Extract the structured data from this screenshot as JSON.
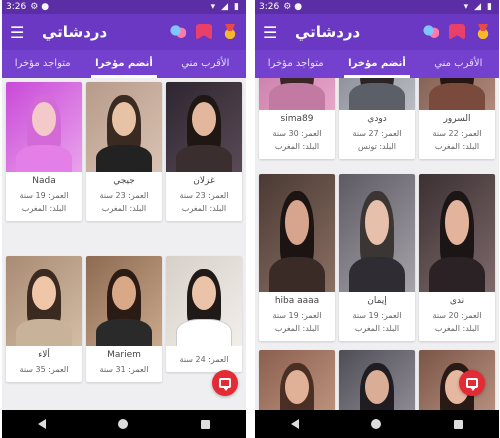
{
  "app": {
    "title": "دردشاتي",
    "status_time": "3:26",
    "tabs": [
      "متواجد مؤخرا",
      "أنضم مؤخرا",
      "الأقرب مني"
    ],
    "active_tab_index": 1,
    "colors": {
      "statusbar": "#5b2ea6",
      "appbar": "#6a38c2",
      "tabs": "#7441cf",
      "fab": "#e32b36"
    }
  },
  "left_screen": {
    "profiles": [
      {
        "name": "غزلان",
        "age": "العمر: 23 سنة",
        "country": "البلد: المغرب"
      },
      {
        "name": "جيجي",
        "age": "العمر: 23 سنة",
        "country": "البلد: المغرب"
      },
      {
        "name": "Nada",
        "age": "العمر: 19 سنة",
        "country": "البلد: المغرب"
      },
      {
        "name": "",
        "age": "العمر: 24 سنة",
        "country": ""
      },
      {
        "name": "Mariem",
        "age": "العمر: 31 سنة",
        "country": ""
      },
      {
        "name": "ألاء",
        "age": "العمر: 35 سنة",
        "country": ""
      }
    ]
  },
  "right_screen": {
    "profiles": [
      {
        "name": "السرور",
        "age": "العمر: 22 سنة",
        "country": "البلد: المغرب"
      },
      {
        "name": "دودي",
        "age": "العمر: 27 سنة",
        "country": "البلد: تونس"
      },
      {
        "name": "sima89",
        "age": "العمر: 30 سنة",
        "country": "البلد: المغرب"
      },
      {
        "name": "ندى",
        "age": "العمر: 20 سنة",
        "country": "البلد: المغرب"
      },
      {
        "name": "إيمان",
        "age": "العمر: 19 سنة",
        "country": "البلد: المغرب"
      },
      {
        "name": "hiba aaaa",
        "age": "العمر: 19 سنة",
        "country": "البلد: المغرب"
      },
      {
        "name": "",
        "age": "",
        "country": ""
      },
      {
        "name": "",
        "age": "",
        "country": ""
      },
      {
        "name": "",
        "age": "",
        "country": ""
      }
    ]
  }
}
